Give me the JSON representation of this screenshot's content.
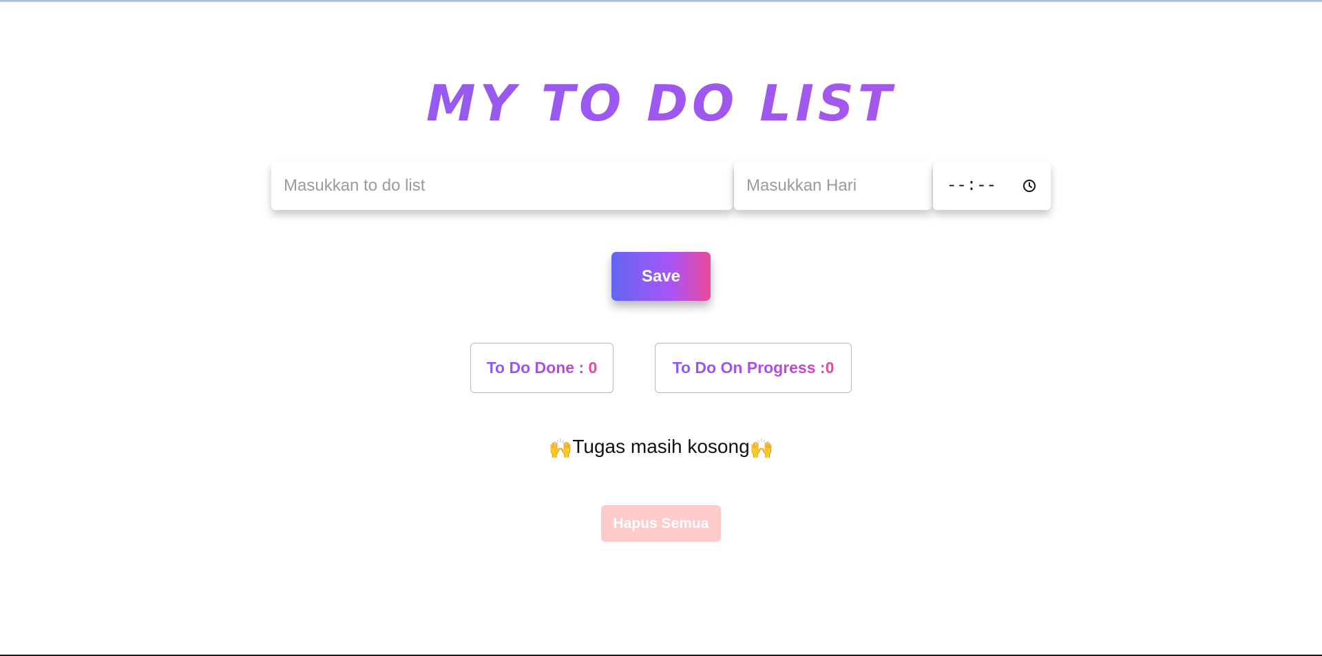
{
  "app": {
    "title": "MY TO DO LIST"
  },
  "form": {
    "todo_placeholder": "Masukkan to do list",
    "todo_value": "",
    "day_placeholder": "Masukkan Hari",
    "day_value": "",
    "time_value": "--:--",
    "save_label": "Save"
  },
  "stats": {
    "done_label": "To Do Done : 0",
    "progress_label": "To Do On Progress :0"
  },
  "list": {
    "empty_emoji": "🙌",
    "empty_text": "Tugas masih kosong"
  },
  "actions": {
    "clear_all_label": "Hapus Semua"
  },
  "colors": {
    "accent_purple": "#8b5cf6",
    "accent_pink": "#ec4899",
    "accent_indigo": "#6366f1",
    "clear_button_bg": "#fecaca"
  },
  "icons": {
    "time": "clock-icon",
    "empty": "raising-hands-emoji"
  }
}
